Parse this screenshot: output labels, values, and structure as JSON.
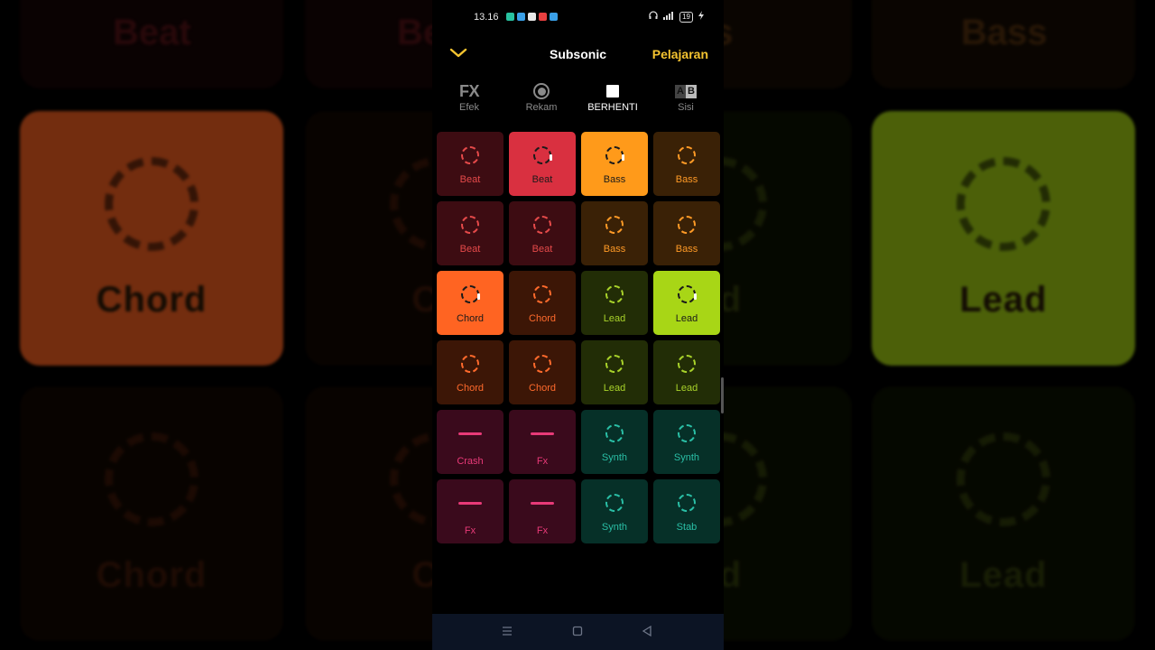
{
  "app": {
    "title": "Subsonic",
    "lesson_label": "Pelajaran",
    "collapse_icon": "chevron-down-icon",
    "accent": "#f5c430"
  },
  "status_bar": {
    "time": "13.16",
    "battery": "19",
    "notification_icons": [
      "#28c2a0",
      "#3aa0e8",
      "#e8e8e8",
      "#e84040",
      "#3aa0e8"
    ]
  },
  "toolbar": [
    {
      "label": "Efek",
      "icon": "fx-icon",
      "glyph": "FX",
      "active": false
    },
    {
      "label": "Rekam",
      "icon": "record-icon",
      "active": false
    },
    {
      "label": "BERHENTI",
      "icon": "stop-icon",
      "active": true
    },
    {
      "label": "Sisi",
      "icon": "ab-side-icon",
      "glyph_a": "A",
      "glyph_b": "B",
      "active": false
    }
  ],
  "pads": [
    [
      {
        "label": "Beat",
        "type": "ring",
        "color": "#e54a4a",
        "active": false
      },
      {
        "label": "Beat",
        "type": "ring",
        "color": "#e54a4a",
        "active": true
      },
      {
        "label": "Bass",
        "type": "ring",
        "color": "#ff9a26",
        "active": true
      },
      {
        "label": "Bass",
        "type": "ring",
        "color": "#ff9a26",
        "active": false
      }
    ],
    [
      {
        "label": "Beat",
        "type": "ring",
        "color": "#e54a4a",
        "active": false
      },
      {
        "label": "Beat",
        "type": "ring",
        "color": "#e54a4a",
        "active": false
      },
      {
        "label": "Bass",
        "type": "ring",
        "color": "#ff9a26",
        "active": false
      },
      {
        "label": "Bass",
        "type": "ring",
        "color": "#ff9a26",
        "active": false
      }
    ],
    [
      {
        "label": "Chord",
        "type": "ring",
        "color": "#ff6a2c",
        "active": true
      },
      {
        "label": "Chord",
        "type": "ring",
        "color": "#ff6a2c",
        "active": false
      },
      {
        "label": "Lead",
        "type": "ring",
        "color": "#a8d22a",
        "active": false
      },
      {
        "label": "Lead",
        "type": "ring",
        "color": "#a8d22a",
        "active": true
      }
    ],
    [
      {
        "label": "Chord",
        "type": "ring",
        "color": "#ff6a2c",
        "active": false
      },
      {
        "label": "Chord",
        "type": "ring",
        "color": "#ff6a2c",
        "active": false
      },
      {
        "label": "Lead",
        "type": "ring",
        "color": "#a8d22a",
        "active": false
      },
      {
        "label": "Lead",
        "type": "ring",
        "color": "#a8d22a",
        "active": false
      }
    ],
    [
      {
        "label": "Crash",
        "type": "dash",
        "color": "#e83a78",
        "active": false
      },
      {
        "label": "Fx",
        "type": "dash",
        "color": "#e83a78",
        "active": false
      },
      {
        "label": "Synth",
        "type": "ring",
        "color": "#2abfa6",
        "active": false
      },
      {
        "label": "Synth",
        "type": "ring",
        "color": "#2abfa6",
        "active": false
      }
    ],
    [
      {
        "label": "Fx",
        "type": "dash",
        "color": "#e83a78",
        "active": false
      },
      {
        "label": "Fx",
        "type": "dash",
        "color": "#e83a78",
        "active": false
      },
      {
        "label": "Synth",
        "type": "ring",
        "color": "#2abfa6",
        "active": false
      },
      {
        "label": "Stab",
        "type": "ring",
        "color": "#2abfa6",
        "active": false
      }
    ]
  ],
  "pad_fills": {
    "#e54a4a": {
      "bg": "#3d0c12",
      "active": "#d93040"
    },
    "#ff9a26": {
      "bg": "#3a2106",
      "active": "#ff9a1a"
    },
    "#ff6a2c": {
      "bg": "#3c1606",
      "active": "#ff6422"
    },
    "#a8d22a": {
      "bg": "#222d06",
      "active": "#a8d616"
    },
    "#e83a78": {
      "bg": "#3a0a1c",
      "active": "#e83a78"
    },
    "#2abfa6": {
      "bg": "#063028",
      "active": "#2abfa6"
    }
  },
  "background_zoom": {
    "top_labels": [
      "Beat",
      "Be",
      "ss",
      "Bass"
    ],
    "tiles": [
      {
        "label": "Chord",
        "color": "#ff6422",
        "dim": false
      },
      {
        "label": "Ch",
        "color": "#ff6a2c",
        "dim": true
      },
      {
        "label": "ad",
        "color": "#a8d22a",
        "dim": true
      },
      {
        "label": "Lead",
        "color": "#a8d616",
        "dim": false
      },
      {
        "label": "Chord",
        "color": "#ff6a2c",
        "dim": true
      },
      {
        "label": "Ch",
        "color": "#ff6a2c",
        "dim": true
      },
      {
        "label": "ad",
        "color": "#a8d22a",
        "dim": true
      },
      {
        "label": "Lead",
        "color": "#a8d22a",
        "dim": true
      }
    ]
  },
  "nav_bar": {
    "menu_icon": "menu-icon",
    "home_icon": "home-icon",
    "back_icon": "back-icon"
  }
}
